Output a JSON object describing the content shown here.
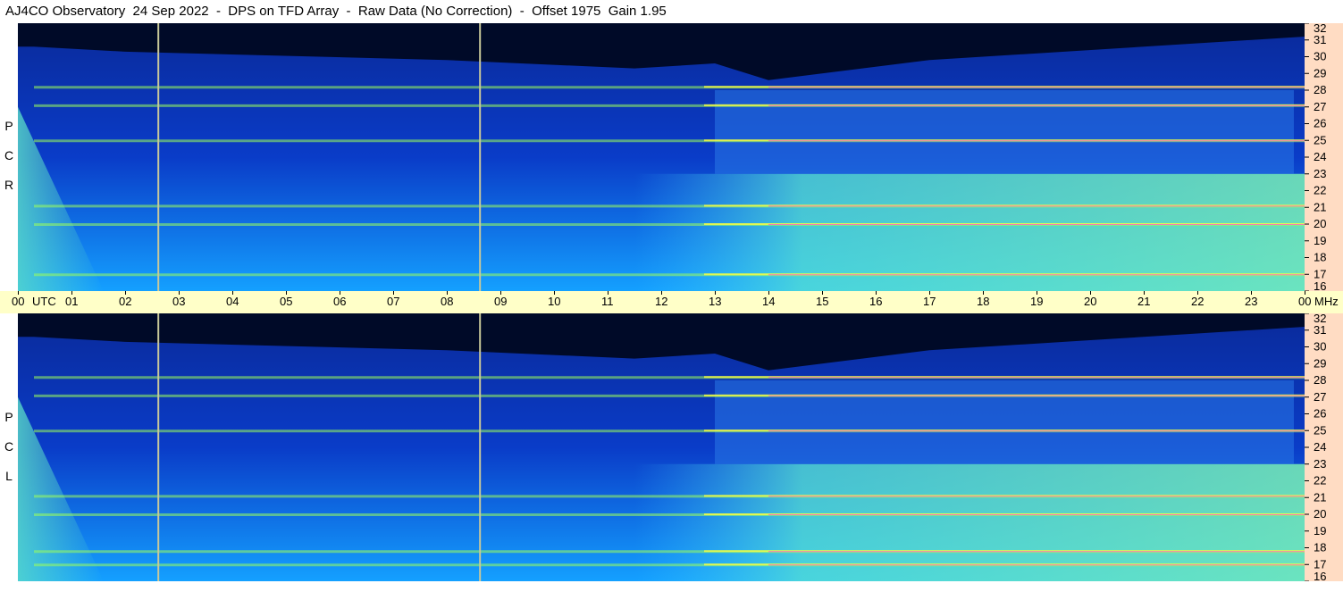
{
  "header": {
    "title": "AJ4CO Observatory  24 Sep 2022  -  DPS on TFD Array  -  Raw Data (No Correction)  -  Offset 1975  Gain 1.95"
  },
  "panels": [
    {
      "id": "rcp",
      "label_letters": [
        "P",
        "C",
        "R"
      ]
    },
    {
      "id": "lcp",
      "label_letters": [
        "P",
        "C",
        "L"
      ]
    }
  ],
  "time_axis": {
    "utc_label": "UTC",
    "hours": [
      "00",
      "01",
      "02",
      "03",
      "04",
      "05",
      "06",
      "07",
      "08",
      "09",
      "10",
      "11",
      "12",
      "13",
      "14",
      "15",
      "16",
      "17",
      "18",
      "19",
      "20",
      "21",
      "22",
      "23",
      "00"
    ]
  },
  "freq_axis": {
    "unit": "MHz",
    "ticks": [
      32,
      31,
      30,
      29,
      28,
      27,
      26,
      25,
      24,
      23,
      22,
      21,
      20,
      19,
      18,
      17,
      16
    ]
  },
  "colors": {
    "background_sky": "#0a3cc8",
    "low_band": "#14a0ff",
    "noise_floor": "#000a28",
    "rfi_green": "#9cff5a",
    "rfi_yellow": "#ffff40",
    "rfi_magenta": "#ff20ff",
    "marker_line": "#c8c89a",
    "time_bar": "#ffffc8",
    "freq_bar": "#ffdcc3"
  },
  "chart_data": [
    {
      "type": "heatmap",
      "title": "AJ4CO Observatory  24 Sep 2022  -  DPS on TFD Array  -  Raw Data (No Correction)  -  Offset 1975  Gain 1.95",
      "panel": "RCP",
      "x_axis": {
        "label": "UTC",
        "range": [
          0,
          24
        ],
        "tick_labels": [
          "00",
          "01",
          "02",
          "03",
          "04",
          "05",
          "06",
          "07",
          "08",
          "09",
          "10",
          "11",
          "12",
          "13",
          "14",
          "15",
          "16",
          "17",
          "18",
          "19",
          "20",
          "21",
          "22",
          "23",
          "00"
        ]
      },
      "y_axis": {
        "label": "MHz",
        "range": [
          16,
          32
        ],
        "tick_labels": [
          32,
          31,
          30,
          29,
          28,
          27,
          26,
          25,
          24,
          23,
          22,
          21,
          20,
          19,
          18,
          17,
          16
        ]
      },
      "vertical_markers_utc": [
        2.62,
        8.62
      ],
      "strong_rfi_bands_mhz": [
        17.0,
        20.0,
        21.1,
        25.0,
        27.1,
        28.2
      ]
    },
    {
      "type": "heatmap",
      "panel": "LCP",
      "x_axis": {
        "label": "UTC",
        "range": [
          0,
          24
        ],
        "tick_labels": [
          "00",
          "01",
          "02",
          "03",
          "04",
          "05",
          "06",
          "07",
          "08",
          "09",
          "10",
          "11",
          "12",
          "13",
          "14",
          "15",
          "16",
          "17",
          "18",
          "19",
          "20",
          "21",
          "22",
          "23",
          "00"
        ]
      },
      "y_axis": {
        "label": "MHz",
        "range": [
          16,
          32
        ],
        "tick_labels": [
          32,
          31,
          30,
          29,
          28,
          27,
          26,
          25,
          24,
          23,
          22,
          21,
          20,
          19,
          18,
          17,
          16
        ]
      },
      "vertical_markers_utc": [
        2.62,
        8.62
      ],
      "strong_rfi_bands_mhz": [
        17.0,
        17.8,
        20.0,
        21.1,
        25.0,
        27.1,
        28.2
      ]
    }
  ]
}
